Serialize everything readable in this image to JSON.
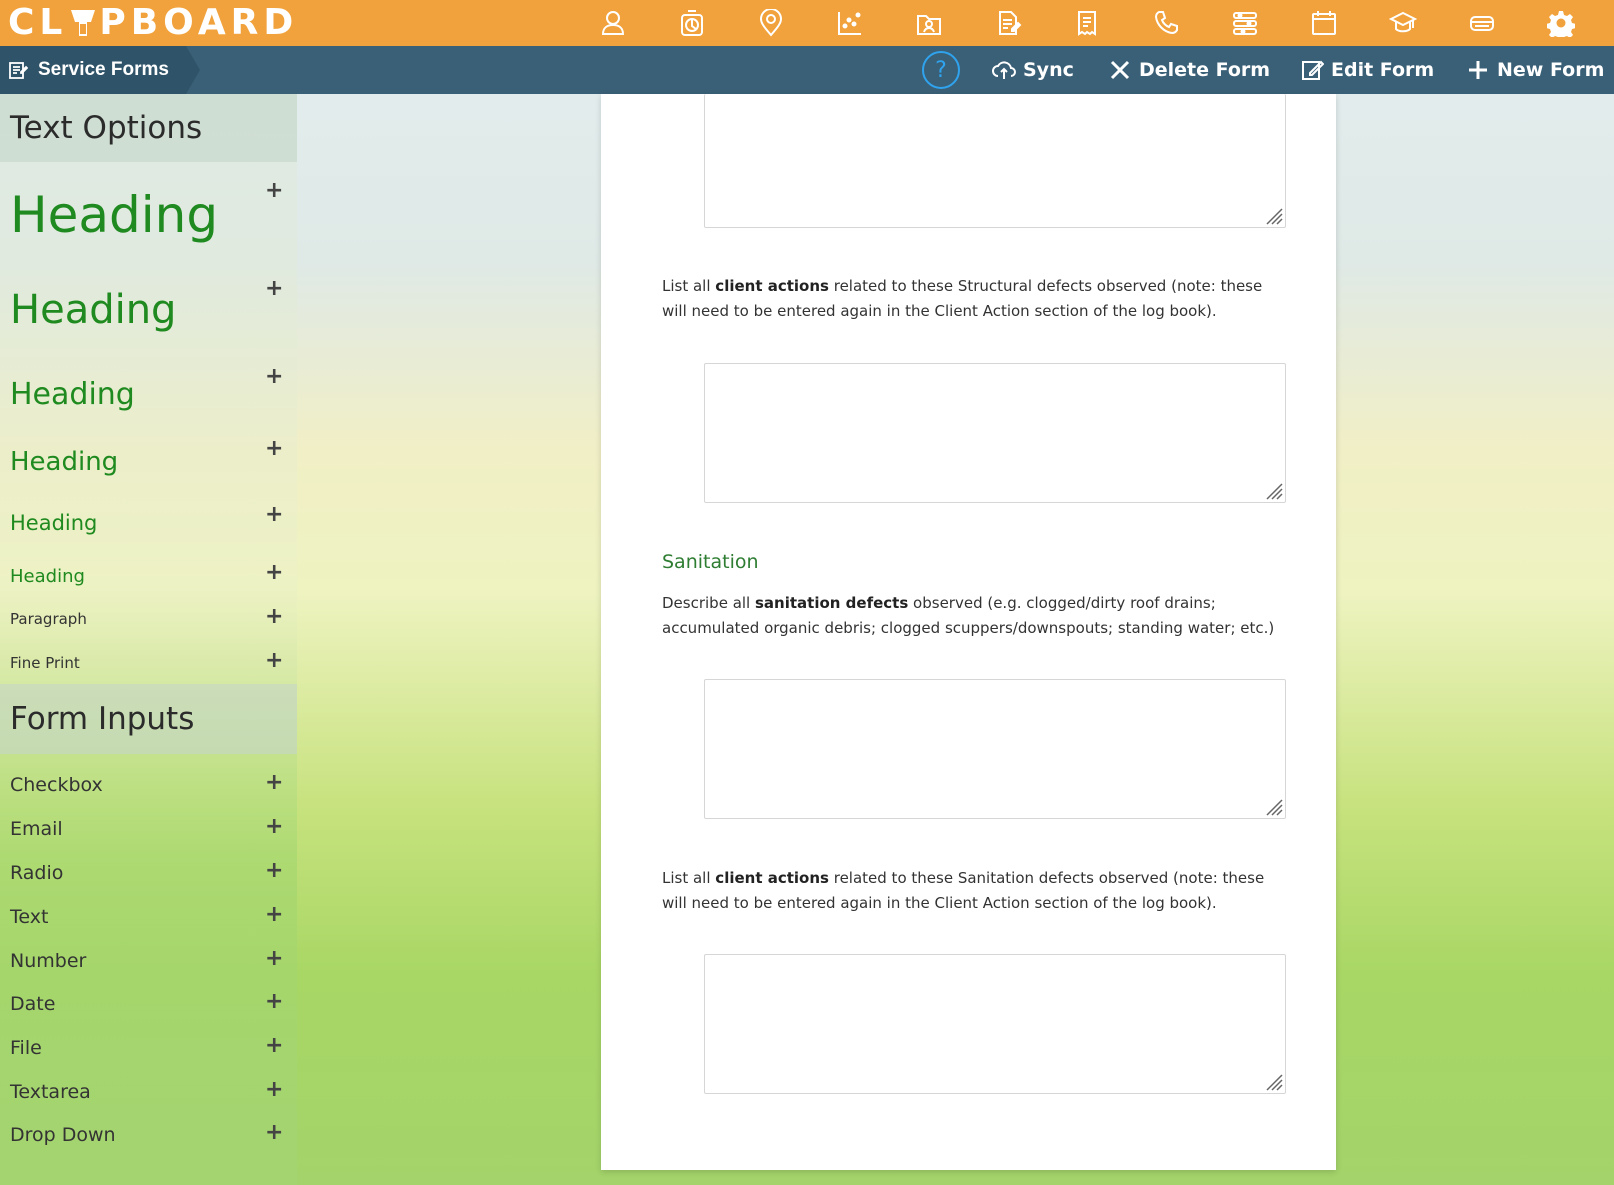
{
  "app": {
    "logo_left": "CL",
    "logo_right": "PBOARD"
  },
  "top_nav": [
    {
      "icon": "user-icon"
    },
    {
      "icon": "timer-icon"
    },
    {
      "icon": "location-icon"
    },
    {
      "icon": "scatter-chart-icon"
    },
    {
      "icon": "contacts-folder-icon"
    },
    {
      "icon": "document-edit-icon"
    },
    {
      "icon": "receipt-icon"
    },
    {
      "icon": "phone-icon"
    },
    {
      "icon": "sliders-icon"
    },
    {
      "icon": "calendar-icon"
    },
    {
      "icon": "graduation-cap-icon"
    },
    {
      "icon": "storage-icon"
    },
    {
      "icon": "gear-icon"
    }
  ],
  "subbar": {
    "section_title": "Service Forms",
    "help_label": "?",
    "sync_label": "Sync",
    "delete_label": "Delete Form",
    "edit_label": "Edit Form",
    "new_label": "New Form"
  },
  "sidebar": {
    "text_options_title": "Text Options",
    "text_options": [
      {
        "label": "Heading"
      },
      {
        "label": "Heading"
      },
      {
        "label": "Heading"
      },
      {
        "label": "Heading"
      },
      {
        "label": "Heading"
      },
      {
        "label": "Heading"
      },
      {
        "label": "Paragraph"
      },
      {
        "label": "Fine Print"
      }
    ],
    "form_inputs_title": "Form Inputs",
    "form_inputs": [
      {
        "label": "Checkbox"
      },
      {
        "label": "Email"
      },
      {
        "label": "Radio"
      },
      {
        "label": "Text"
      },
      {
        "label": "Number"
      },
      {
        "label": "Date"
      },
      {
        "label": "File"
      },
      {
        "label": "Textarea"
      },
      {
        "label": "Drop Down"
      }
    ],
    "plus": "+"
  },
  "form": {
    "structural_actions": {
      "pre": "List all ",
      "bold": "client actions",
      "post": " related to these Structural defects observed (note: these will need to be entered again in the Client Action section of the log book)."
    },
    "sanitation_heading": "Sanitation",
    "sanitation_defects": {
      "pre": "Describe all ",
      "bold": "sanitation defects",
      "post": " observed (e.g. clogged/dirty roof drains; accumulated organic debris; clogged scuppers/downspouts; standing water; etc.)"
    },
    "sanitation_actions": {
      "pre": "List all ",
      "bold": "client actions",
      "post": " related to these Sanitation defects observed (note: these will need to be entered again in the Client Action section of the log book)."
    }
  }
}
